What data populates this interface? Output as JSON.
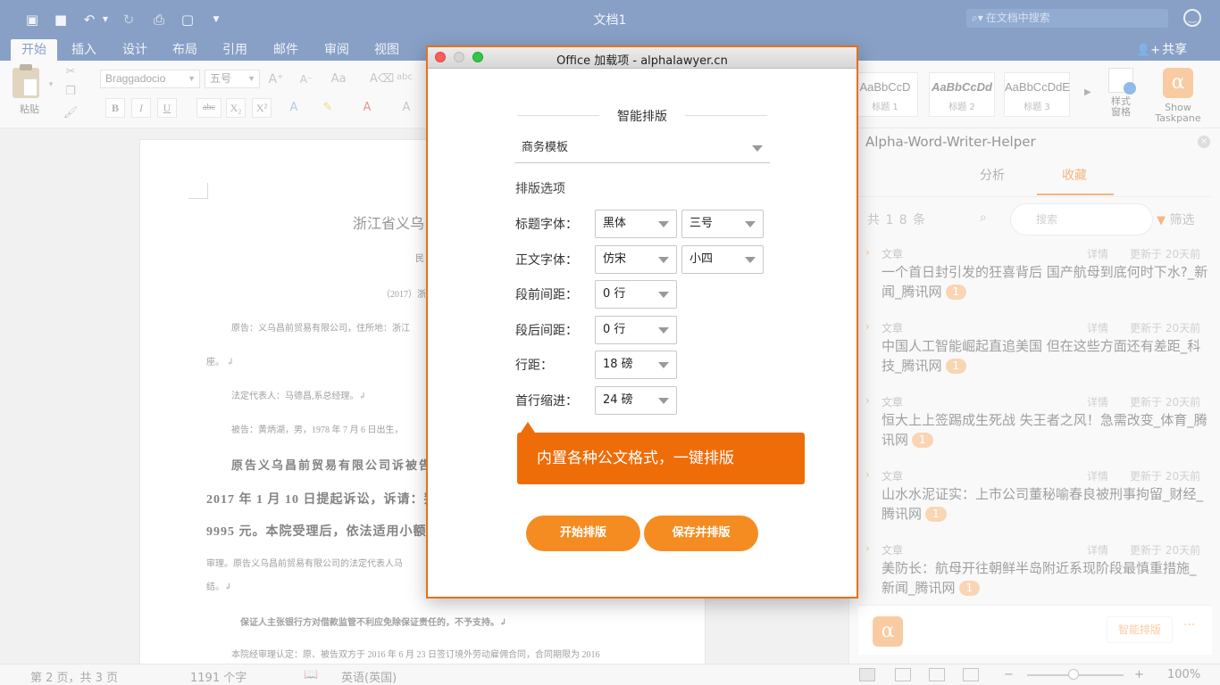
{
  "titlebar": {
    "doc_title": "文档1",
    "search_placeholder": "在文档中搜索",
    "icons": [
      "sidebar-icon",
      "save-icon",
      "undo-icon",
      "redo-icon",
      "print-icon",
      "new-doc-icon",
      "customize-icon",
      "smiley-icon"
    ]
  },
  "ribbon": {
    "tabs": [
      "开始",
      "插入",
      "设计",
      "布局",
      "引用",
      "邮件",
      "审阅",
      "视图"
    ],
    "share_label": "共享",
    "paste_label": "粘贴",
    "font_name": "Braggadocio",
    "font_size": "五号",
    "styles": [
      {
        "sample": "AaBbCcD",
        "caption": "标题 1"
      },
      {
        "sample": "AaBbCcDd",
        "caption": "标题 2"
      },
      {
        "sample": "AaBbCcDdE",
        "caption": "标题 3"
      }
    ],
    "style_pane_label_1": "样式",
    "style_pane_label_2": "窗格",
    "show_taskpane_1": "Show",
    "show_taskpane_2": "Taskpane",
    "format_buttons": [
      "B",
      "I",
      "U",
      "abc",
      "X₂",
      "X²"
    ]
  },
  "document": {
    "title": "浙江省义乌",
    "lines": [
      "民",
      "（2017）浙",
      "原告：义乌昌前贸易有限公司，住所地：浙江",
      "座。 ↲",
      "法定代表人：马德昌,系总经理。↲",
      "被告：黄炳湖，男，1978 年 7 月 6 日出生，",
      "原告义乌昌前贸易有限公司诉被告",
      "2017 年 1 月 10 日提起诉讼，诉请：判",
      "9995 元。本院受理后，依法适用小额",
      "审理。原告义乌昌前贸易有限公司的法定代表人马",
      "结。↲",
      "保证人主张银行方对借款监管不利应免除保证责任的，不予支持。↲",
      "本院经审理认定：原、被告双方于 2016 年 6 月 23 日签订境外劳动雇佣合同，合同期限为 2016"
    ]
  },
  "taskpane": {
    "title": "Alpha-Word-Writer-Helper",
    "tabs": [
      "分析",
      "收藏"
    ],
    "active_tab": "收藏",
    "count": "共 1 8 条",
    "search_placeholder": "搜索",
    "filter_label": "筛选",
    "articles": [
      {
        "type": "文章",
        "detail": "详情",
        "updated": "更新于 20天前",
        "title": "一个首日封引发的狂喜背后 国产航母到底何时下水?_新闻_腾讯网",
        "badge": "1"
      },
      {
        "type": "文章",
        "detail": "详情",
        "updated": "更新于 20天前",
        "title": "中国人工智能崛起直追美国 但在这些方面还有差距_科技_腾讯网",
        "badge": "1"
      },
      {
        "type": "文章",
        "detail": "详情",
        "updated": "更新于 20天前",
        "title": "恒大上上签踢成生死战 失王者之风！急需改变_体育_腾讯网",
        "badge": "1"
      },
      {
        "type": "文章",
        "detail": "详情",
        "updated": "更新于 20天前",
        "title": "山水水泥证实：上市公司董秘喻春良被刑事拘留_财经_腾讯网",
        "badge": "1"
      },
      {
        "type": "文章",
        "detail": "详情",
        "updated": "更新于 20天前",
        "title": "美防长：航母开往朝鲜半岛附近系现阶段最慎重措施_新闻_腾讯网",
        "badge": "1"
      }
    ],
    "bottom_button": "智能排版",
    "more": "···",
    "logo_glyph": "α"
  },
  "dialog": {
    "title": "Office 加载项 - alphalawyer.cn",
    "heading": "智能排版",
    "template": "商务模板",
    "options_heading": "排版选项",
    "rows": [
      {
        "label": "标题字体：",
        "values": [
          "黑体",
          "三号"
        ]
      },
      {
        "label": "正文字体：",
        "values": [
          "仿宋",
          "小四"
        ]
      },
      {
        "label": "段前间距：",
        "values": [
          "0 行"
        ]
      },
      {
        "label": "段后间距：",
        "values": [
          "0 行"
        ]
      },
      {
        "label": "行距：",
        "values": [
          "18 磅"
        ]
      },
      {
        "label": "首行缩进：",
        "values": [
          "24 磅"
        ]
      }
    ],
    "callout": "内置各种公文格式，一键排版",
    "start_button": "开始排版",
    "save_button": "保存并排版"
  },
  "statusbar": {
    "page": "第 2 页，共 3 页",
    "words": "1191 个字",
    "language": "英语(英国)",
    "zoom": "100%",
    "zoom_level": 1.0
  },
  "colors": {
    "word_blue": "#2b579a",
    "accent_orange": "#ee6d08",
    "button_orange": "#f58c22"
  }
}
